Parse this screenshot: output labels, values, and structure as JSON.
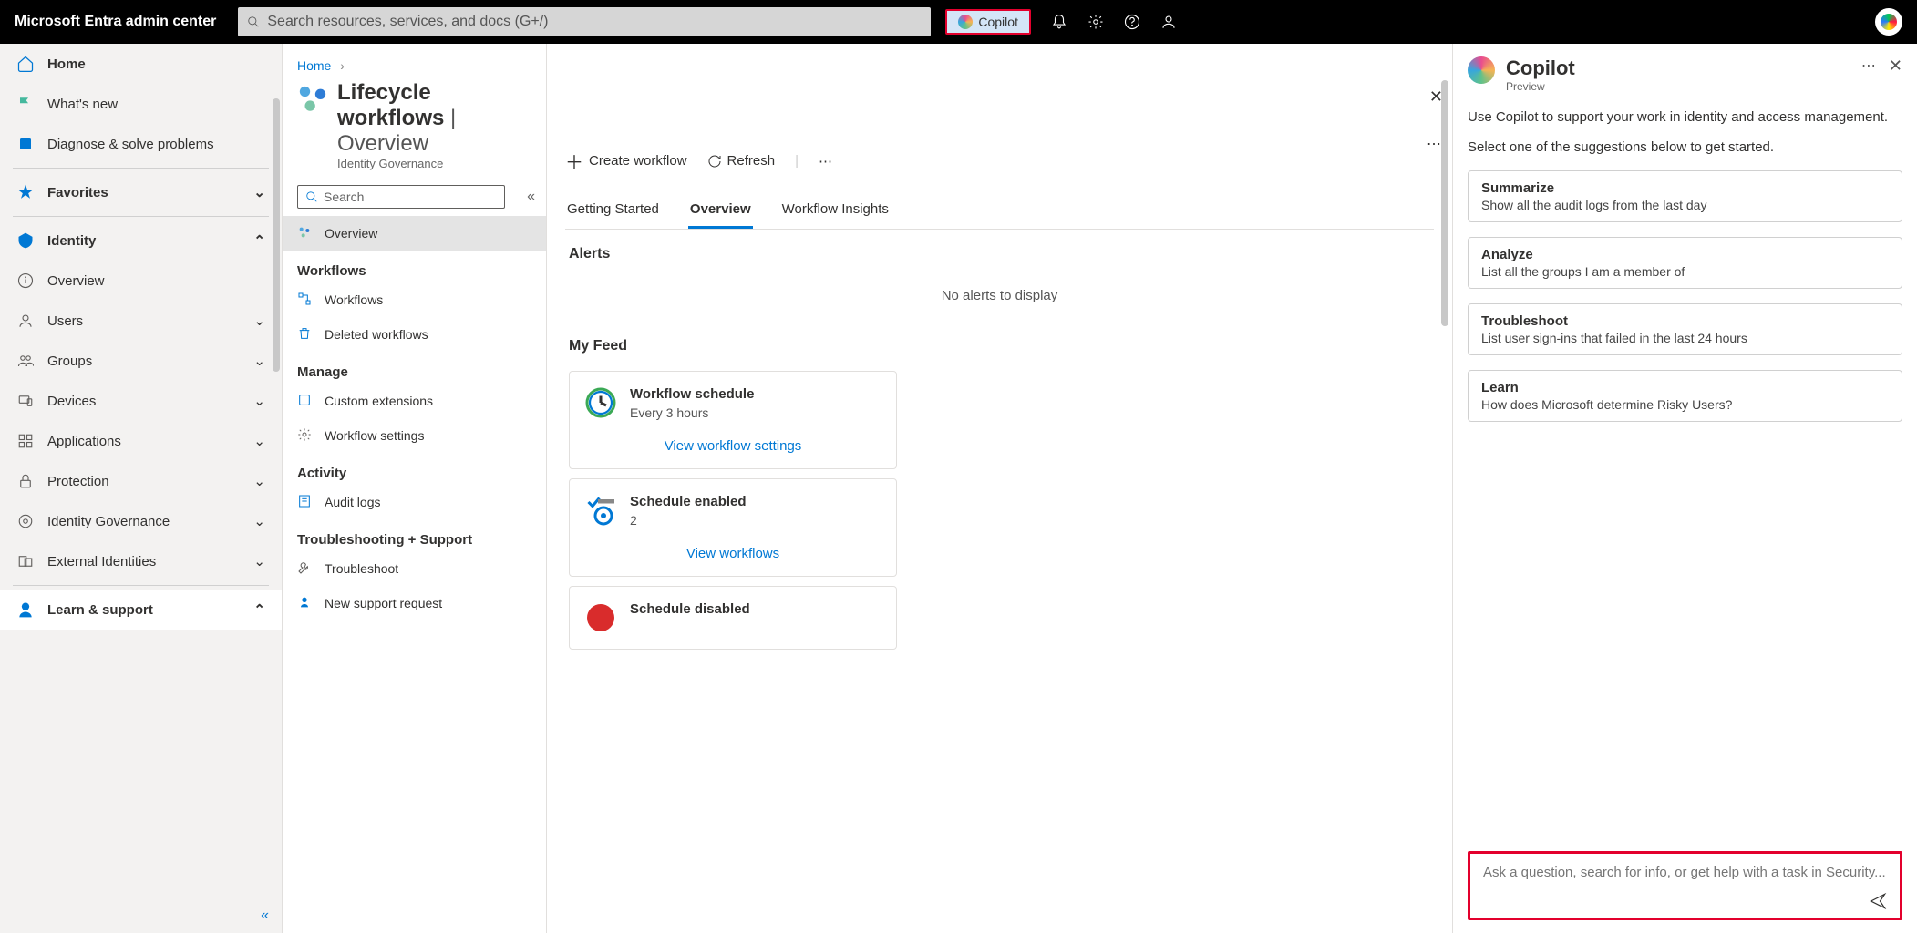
{
  "topbar": {
    "brand": "Microsoft Entra admin center",
    "search_placeholder": "Search resources, services, and docs (G+/)",
    "copilot_btn": "Copilot"
  },
  "sidebar": {
    "home": "Home",
    "whats_new": "What's new",
    "diagnose": "Diagnose & solve problems",
    "favorites": "Favorites",
    "identity": "Identity",
    "overview": "Overview",
    "users": "Users",
    "groups": "Groups",
    "devices": "Devices",
    "applications": "Applications",
    "protection": "Protection",
    "identity_governance": "Identity Governance",
    "external_identities": "External Identities",
    "learn_support": "Learn & support"
  },
  "breadcrumb": {
    "home": "Home"
  },
  "page": {
    "title_main": "Lifecycle workflows",
    "title_sep": " | ",
    "title_sub": "Overview",
    "subtitle": "Identity Governance",
    "search_placeholder": "Search"
  },
  "secondary": {
    "overview": "Overview",
    "g_workflows": "Workflows",
    "workflows": "Workflows",
    "deleted": "Deleted workflows",
    "g_manage": "Manage",
    "custom_ext": "Custom extensions",
    "wf_settings": "Workflow settings",
    "g_activity": "Activity",
    "audit_logs": "Audit logs",
    "g_troubleshoot": "Troubleshooting + Support",
    "troubleshoot": "Troubleshoot",
    "new_support": "New support request"
  },
  "toolbar": {
    "create": "Create workflow",
    "refresh": "Refresh"
  },
  "tabs": {
    "getting_started": "Getting Started",
    "overview": "Overview",
    "insights": "Workflow Insights"
  },
  "alerts": {
    "heading": "Alerts",
    "empty": "No alerts to display"
  },
  "feed": {
    "heading": "My Feed",
    "card1_title": "Workflow schedule",
    "card1_sub": "Every 3 hours",
    "card1_link": "View workflow settings",
    "card2_title": "Schedule enabled",
    "card2_sub": "2",
    "card2_link": "View workflows",
    "card3_title": "Schedule disabled"
  },
  "copilot": {
    "title": "Copilot",
    "preview": "Preview",
    "intro1": "Use Copilot to support your work in identity and access management.",
    "intro2": "Select one of the suggestions below to get started.",
    "s1_t": "Summarize",
    "s1_d": "Show all the audit logs from the last day",
    "s2_t": "Analyze",
    "s2_d": "List all the groups I am a member of",
    "s3_t": "Troubleshoot",
    "s3_d": "List user sign-ins that failed in the last 24 hours",
    "s4_t": "Learn",
    "s4_d": "How does Microsoft determine Risky Users?",
    "input_placeholder": "Ask a question, search for info, or get help with a task in Security..."
  }
}
